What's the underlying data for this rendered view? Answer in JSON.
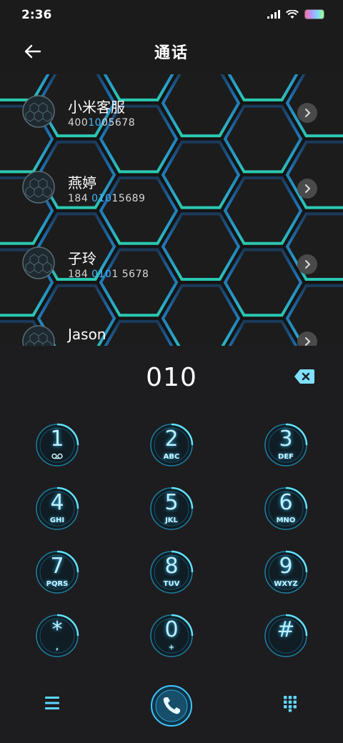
{
  "status": {
    "time": "2:36"
  },
  "header": {
    "title": "通话"
  },
  "contacts": [
    {
      "name": "小米客服",
      "number_parts": [
        "400",
        "10",
        "05678"
      ]
    },
    {
      "name": "燕婷",
      "number_parts": [
        "184 ",
        "010",
        "15689"
      ]
    },
    {
      "name": "子玲",
      "number_parts": [
        "184 ",
        "010",
        "1 5678"
      ]
    },
    {
      "name": "Jason",
      "number_parts": [
        "",
        "",
        ""
      ]
    }
  ],
  "dialer": {
    "input": "010",
    "keys": [
      {
        "digit": "1",
        "letters": ""
      },
      {
        "digit": "2",
        "letters": "ABC"
      },
      {
        "digit": "3",
        "letters": "DEF"
      },
      {
        "digit": "4",
        "letters": "GHI"
      },
      {
        "digit": "5",
        "letters": "JKL"
      },
      {
        "digit": "6",
        "letters": "MNO"
      },
      {
        "digit": "7",
        "letters": "PQRS"
      },
      {
        "digit": "8",
        "letters": "TUV"
      },
      {
        "digit": "9",
        "letters": "WXYZ"
      },
      {
        "digit": "*",
        "letters": ","
      },
      {
        "digit": "0",
        "letters": "+"
      },
      {
        "digit": "#",
        "letters": ""
      }
    ]
  },
  "colors": {
    "accent": "#29c3ff",
    "highlight": "#44b4ff",
    "background": "#1d1d1f"
  },
  "icons": {
    "back": "arrow-left-icon",
    "delete": "backspace-icon",
    "menu": "menu-icon",
    "call": "phone-icon",
    "keypad": "dialpad-icon",
    "voicemail": "voicemail-icon"
  }
}
